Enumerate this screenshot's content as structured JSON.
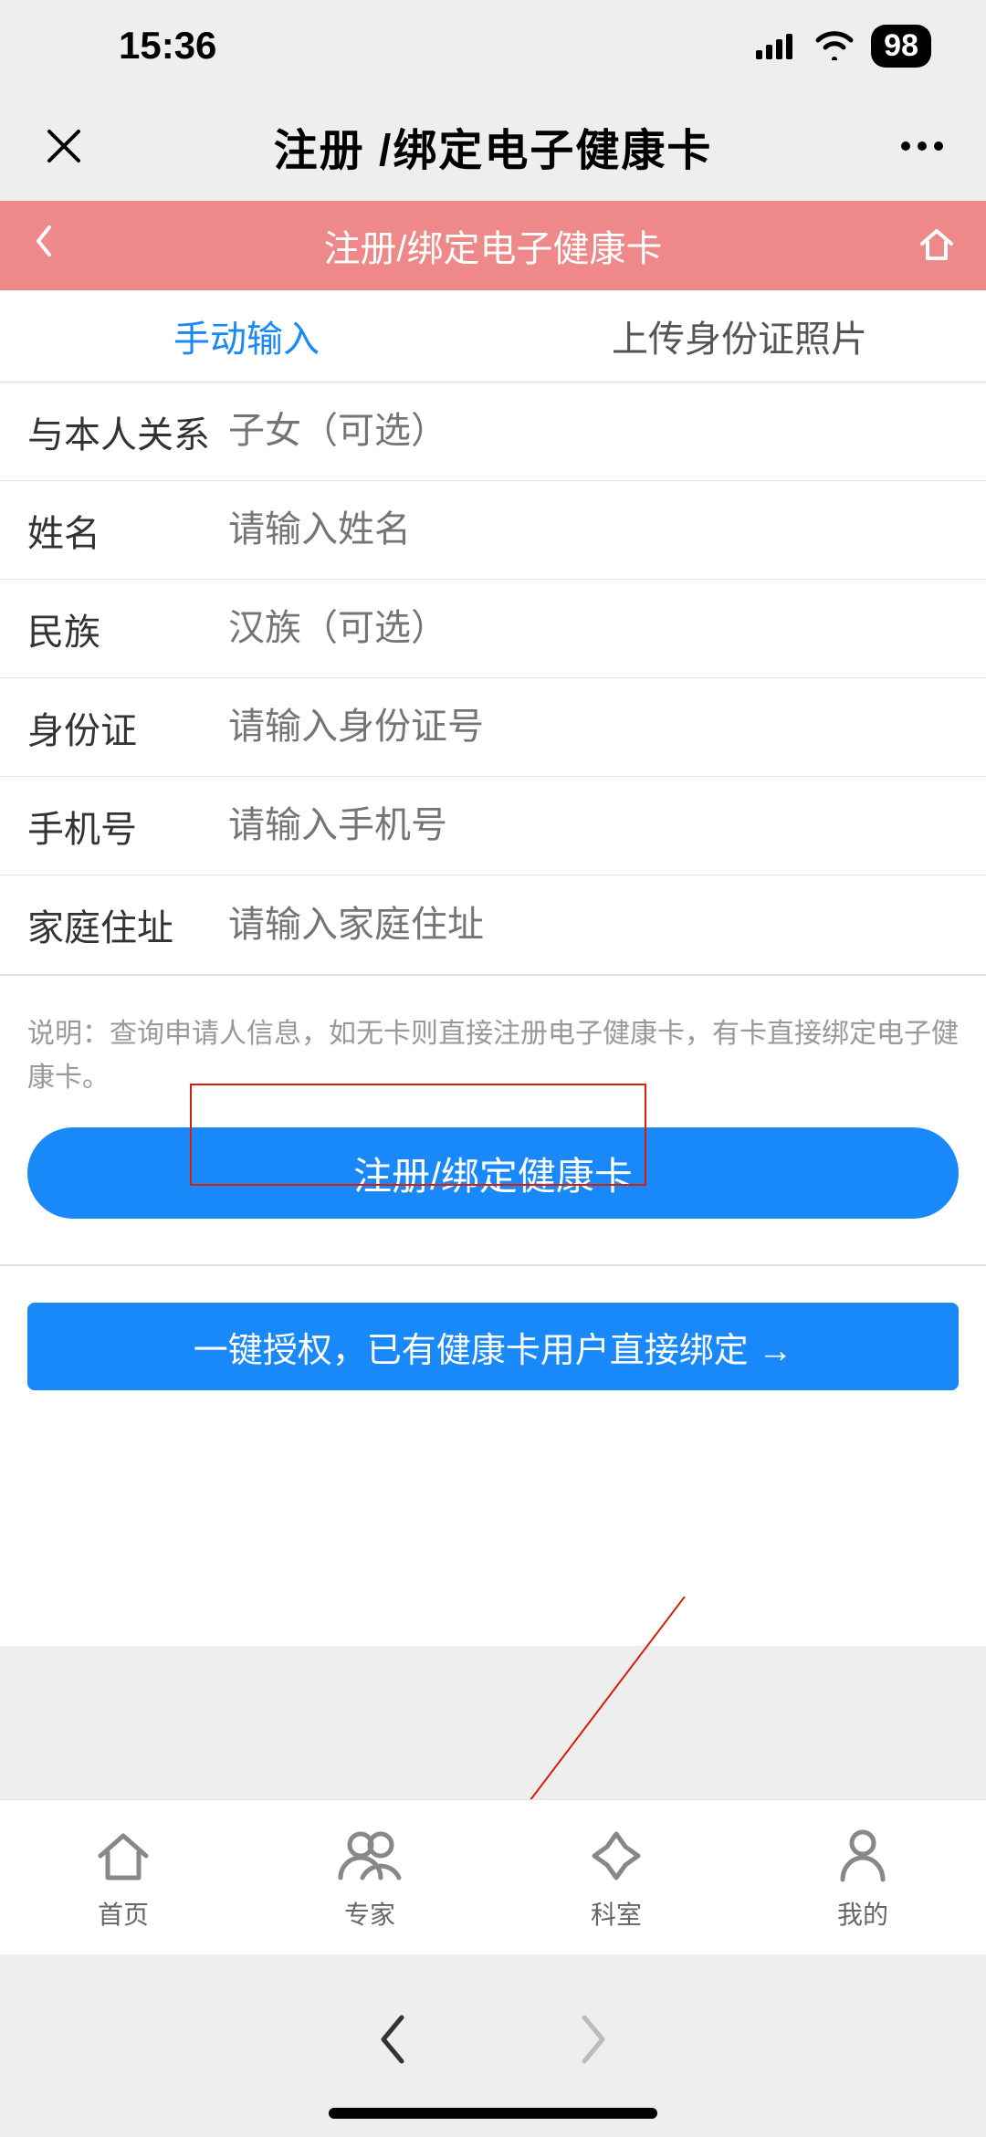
{
  "status": {
    "time": "15:36",
    "battery": "98"
  },
  "top_nav": {
    "title": "注册 /绑定电子健康卡"
  },
  "pink_header": {
    "title": "注册/绑定电子健康卡"
  },
  "tabs": {
    "manual": "手动输入",
    "upload": "上传身份证照片"
  },
  "form": {
    "relation": {
      "label": "与本人关系",
      "placeholder": "子女（可选）"
    },
    "name": {
      "label": "姓名",
      "placeholder": "请输入姓名"
    },
    "ethnic": {
      "label": "民族",
      "placeholder": "汉族（可选）"
    },
    "idcard": {
      "label": "身份证",
      "placeholder": "请输入身份证号"
    },
    "phone": {
      "label": "手机号",
      "placeholder": "请输入手机号"
    },
    "address": {
      "label": "家庭住址",
      "placeholder": "请输入家庭住址"
    }
  },
  "desc": "说明：查询申请人信息，如无卡则直接注册电子健康卡，有卡直接绑定电子健康卡。",
  "buttons": {
    "primary": "注册/绑定健康卡",
    "secondary": "一键授权，已有健康卡用户直接绑定 →"
  },
  "bottom": {
    "home": "首页",
    "expert": "专家",
    "dept": "科室",
    "mine": "我的"
  }
}
